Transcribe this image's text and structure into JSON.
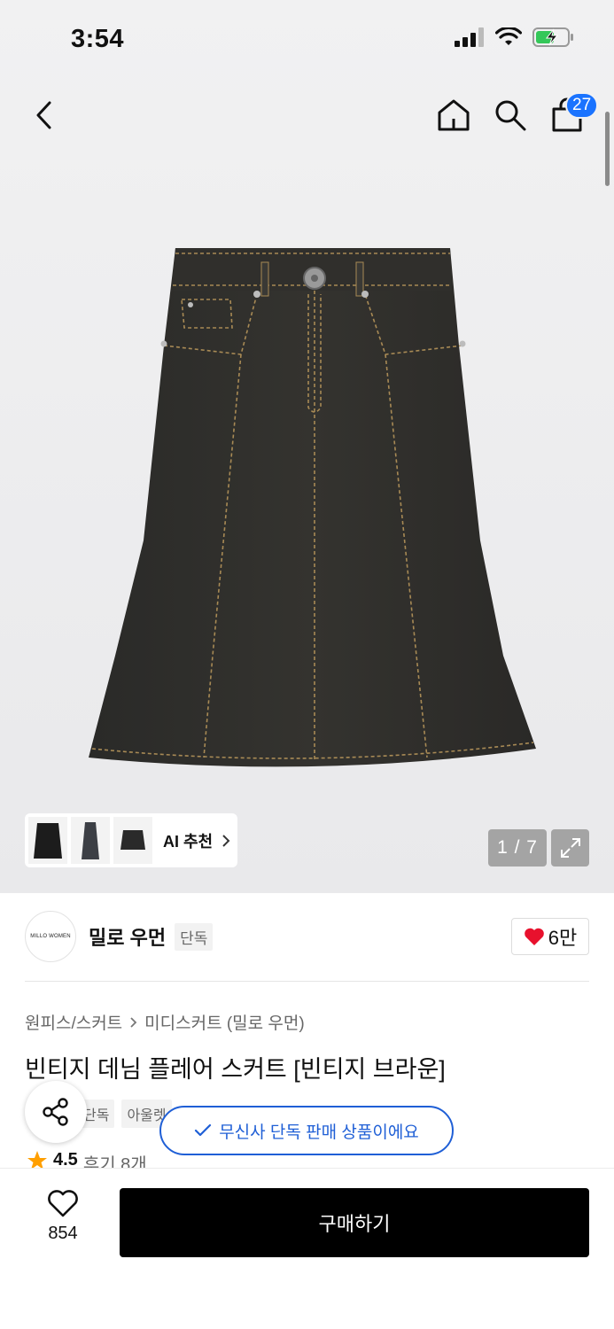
{
  "status_bar": {
    "time": "3:54"
  },
  "nav": {
    "cart_count": "27"
  },
  "image": {
    "ai_recommend_label": "AI 추천",
    "page_indicator": "1 / 7"
  },
  "brand": {
    "logo_text": "MILLO WOMEN",
    "name": "밀로 우먼",
    "tag": "단독",
    "likes": "6만"
  },
  "product": {
    "breadcrumb": [
      "원피스/스커트",
      "미디스커트 (밀로 우먼)"
    ],
    "title": "빈티지 데님 플레어 스커트 [빈티지 브라운]",
    "tags": [
      "단독",
      "아울렛"
    ],
    "exclusive_notice": "무신사 단독 판매 상품이에요",
    "rating": "4.5",
    "reviews": "후기 8개"
  },
  "bottom": {
    "wish_count": "854",
    "buy_label": "구매하기"
  },
  "colors": {
    "accent_blue": "#1f5fd6",
    "badge_blue": "#1a73ff",
    "heart_red": "#e8112d",
    "star_orange": "#ff9f00"
  }
}
